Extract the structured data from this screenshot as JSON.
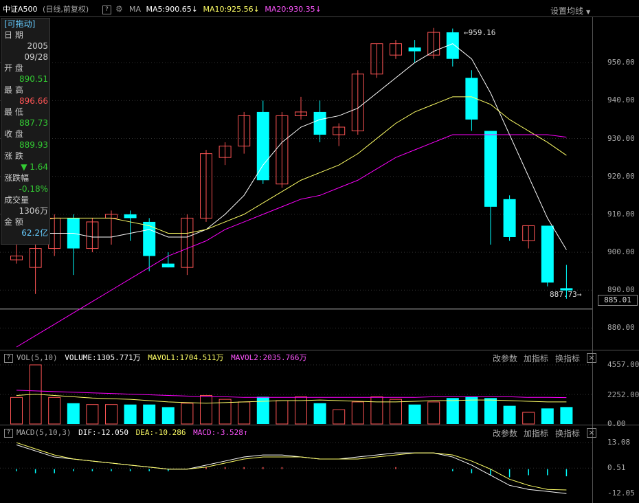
{
  "header": {
    "title": "中证A500",
    "period": "(日线,前复权)",
    "help": "?",
    "ma_label": "MA",
    "ma5": "MA5:900.65",
    "ma10": "MA10:925.56",
    "ma20": "MA20:930.35",
    "settings": "设置均线",
    "arrow_down": "↓",
    "arrow_up": "↑"
  },
  "colors": {
    "up": "#ff5555",
    "down": "#00ffff",
    "ma5": "#ffffff",
    "ma10": "#ffff66",
    "ma20": "#ff00ff",
    "bg": "#000000",
    "grid": "#3a3a3a"
  },
  "infobox": {
    "drag": "[可拖动]",
    "date_label": "日 期",
    "date_year": "2005",
    "date_md": "09/28",
    "open_label": "开 盘",
    "open": "890.51",
    "high_label": "最 高",
    "high": "896.66",
    "low_label": "最 低",
    "low": "887.73",
    "close_label": "收 盘",
    "close": "889.93",
    "change_label": "涨 跌",
    "change": "▼ 1.64",
    "pct_label": "涨跌幅",
    "pct": "-0.18%",
    "vol_label": "成交量",
    "vol": "1306万",
    "amt_label": "金 额",
    "amt": "62.2亿"
  },
  "price_axis": [
    "950.00",
    "940.00",
    "930.00",
    "920.00",
    "910.00",
    "900.00",
    "890.00",
    "880.00"
  ],
  "current_price_tag": "885.01",
  "max_label": "959.16",
  "min_label": "887.73",
  "vol_panel": {
    "help": "?",
    "name": "VOL(5,10)",
    "volume": "VOLUME:1305.771万",
    "mavol1": "MAVOL1:1704.511万",
    "mavol2": "MAVOL2:2035.766万",
    "axis": [
      "4557.00",
      "2252.00",
      "0.00"
    ],
    "tools": [
      "改参数",
      "加指标",
      "换指标"
    ],
    "close": "×"
  },
  "macd_panel": {
    "help": "?",
    "name": "MACD(5,10,3)",
    "dif": "DIF:-12.050",
    "dea": "DEA:-10.286",
    "macd": "MACD:-3.528",
    "axis": [
      "13.08",
      "0.51",
      "-12.05"
    ],
    "tools": [
      "改参数",
      "加指标",
      "换指标"
    ],
    "close": "×"
  },
  "chart_data": {
    "type": "candlestick",
    "ylim_price": [
      875,
      962
    ],
    "candles": [
      {
        "o": 898,
        "h": 907,
        "l": 897,
        "c": 899,
        "v": 2050
      },
      {
        "o": 896,
        "h": 902,
        "l": 889,
        "c": 901,
        "v": 4557
      },
      {
        "o": 901,
        "h": 910,
        "l": 899,
        "c": 909,
        "v": 2050
      },
      {
        "o": 909,
        "h": 910,
        "l": 894,
        "c": 901,
        "v": 1600
      },
      {
        "o": 901,
        "h": 909,
        "l": 900,
        "c": 908,
        "v": 1500
      },
      {
        "o": 909,
        "h": 911,
        "l": 902,
        "c": 910,
        "v": 1500
      },
      {
        "o": 910,
        "h": 911,
        "l": 903,
        "c": 909,
        "v": 1500
      },
      {
        "o": 908,
        "h": 909,
        "l": 895,
        "c": 899,
        "v": 1500
      },
      {
        "o": 897,
        "h": 900,
        "l": 896,
        "c": 896,
        "v": 1300
      },
      {
        "o": 896,
        "h": 910,
        "l": 894,
        "c": 909,
        "v": 1600
      },
      {
        "o": 909,
        "h": 927,
        "l": 908,
        "c": 926,
        "v": 2200
      },
      {
        "o": 925,
        "h": 929,
        "l": 923,
        "c": 928,
        "v": 1900
      },
      {
        "o": 928,
        "h": 937,
        "l": 926,
        "c": 936,
        "v": 1700
      },
      {
        "o": 937,
        "h": 940,
        "l": 918,
        "c": 919,
        "v": 2100
      },
      {
        "o": 918,
        "h": 937,
        "l": 917,
        "c": 936,
        "v": 1800
      },
      {
        "o": 936,
        "h": 941,
        "l": 935,
        "c": 937,
        "v": 2100
      },
      {
        "o": 937,
        "h": 940,
        "l": 929,
        "c": 931,
        "v": 1600
      },
      {
        "o": 931,
        "h": 934,
        "l": 928,
        "c": 933,
        "v": 1100
      },
      {
        "o": 932,
        "h": 948,
        "l": 931,
        "c": 947,
        "v": 1700
      },
      {
        "o": 947,
        "h": 955,
        "l": 946,
        "c": 955,
        "v": 2100
      },
      {
        "o": 952,
        "h": 956,
        "l": 951,
        "c": 955,
        "v": 1900
      },
      {
        "o": 954,
        "h": 956,
        "l": 950,
        "c": 953,
        "v": 1500
      },
      {
        "o": 952,
        "h": 959.16,
        "l": 951,
        "c": 958,
        "v": 1700
      },
      {
        "o": 958,
        "h": 959,
        "l": 949,
        "c": 951,
        "v": 2000
      },
      {
        "o": 946,
        "h": 948,
        "l": 932,
        "c": 935,
        "v": 2100
      },
      {
        "o": 932,
        "h": 932,
        "l": 902,
        "c": 912,
        "v": 2000
      },
      {
        "o": 914,
        "h": 915,
        "l": 903,
        "c": 904,
        "v": 1400
      },
      {
        "o": 903,
        "h": 907,
        "l": 901,
        "c": 907,
        "v": 900
      },
      {
        "o": 907,
        "h": 907,
        "l": 891,
        "c": 892,
        "v": 1200
      },
      {
        "o": 890.51,
        "h": 896.66,
        "l": 887.73,
        "c": 889.93,
        "v": 1305.771
      }
    ],
    "ma5": [
      906,
      905,
      905,
      905,
      904,
      904,
      905,
      906,
      904,
      904,
      906,
      910,
      915,
      923,
      929,
      933,
      935,
      936,
      938,
      942,
      946,
      950,
      953,
      955,
      951,
      942,
      931,
      920,
      909,
      900.65
    ],
    "ma10": [
      908,
      908,
      909,
      909,
      909,
      909,
      908,
      907,
      905,
      905,
      906,
      908,
      910,
      913,
      916,
      919,
      921,
      923,
      926,
      930,
      934,
      937,
      939,
      941,
      941,
      939,
      935,
      932,
      929,
      925.56
    ],
    "ma20": [
      875,
      878,
      881,
      884,
      887,
      890,
      893,
      896,
      899,
      901,
      903,
      906,
      908,
      910,
      912,
      914,
      915,
      917,
      919,
      922,
      925,
      927,
      929,
      931,
      931,
      931,
      931,
      931,
      931,
      930.35
    ],
    "mavol1": [
      2200,
      2300,
      2200,
      2100,
      2000,
      1950,
      1900,
      1800,
      1700,
      1650,
      1600,
      1650,
      1700,
      1750,
      1800,
      1800,
      1850,
      1800,
      1750,
      1700,
      1700,
      1750,
      1800,
      1800,
      1850,
      1850,
      1800,
      1750,
      1700,
      1704.511
    ],
    "mavol2": [
      2600,
      2550,
      2500,
      2450,
      2400,
      2350,
      2300,
      2250,
      2200,
      2150,
      2100,
      2100,
      2050,
      2050,
      2050,
      2050,
      2050,
      2050,
      2050,
      2050,
      2050,
      2050,
      2100,
      2100,
      2100,
      2100,
      2100,
      2050,
      2050,
      2035.766
    ],
    "dif": [
      12,
      9,
      6,
      5,
      4,
      3,
      2,
      1,
      0,
      0,
      2,
      4,
      6,
      7,
      7,
      6,
      5,
      5,
      6,
      7,
      8,
      8,
      8,
      6,
      2,
      -3,
      -8,
      -10,
      -11,
      -12.05
    ],
    "dea": [
      13.08,
      10,
      7,
      5,
      4,
      3,
      2,
      1,
      0,
      0,
      1,
      3,
      5,
      6,
      6,
      6,
      5,
      5,
      5,
      6,
      7,
      8,
      8,
      7,
      4,
      0,
      -5,
      -8,
      -10,
      -10.286
    ],
    "macd": [
      -1,
      -2,
      -2,
      -1,
      -1,
      -1,
      -1,
      -1,
      -1,
      0,
      1,
      1,
      1,
      1,
      1,
      0,
      0,
      0,
      0,
      0,
      1,
      0,
      0,
      -1,
      -2,
      -3,
      -4,
      -3,
      -3,
      -3.528
    ]
  }
}
